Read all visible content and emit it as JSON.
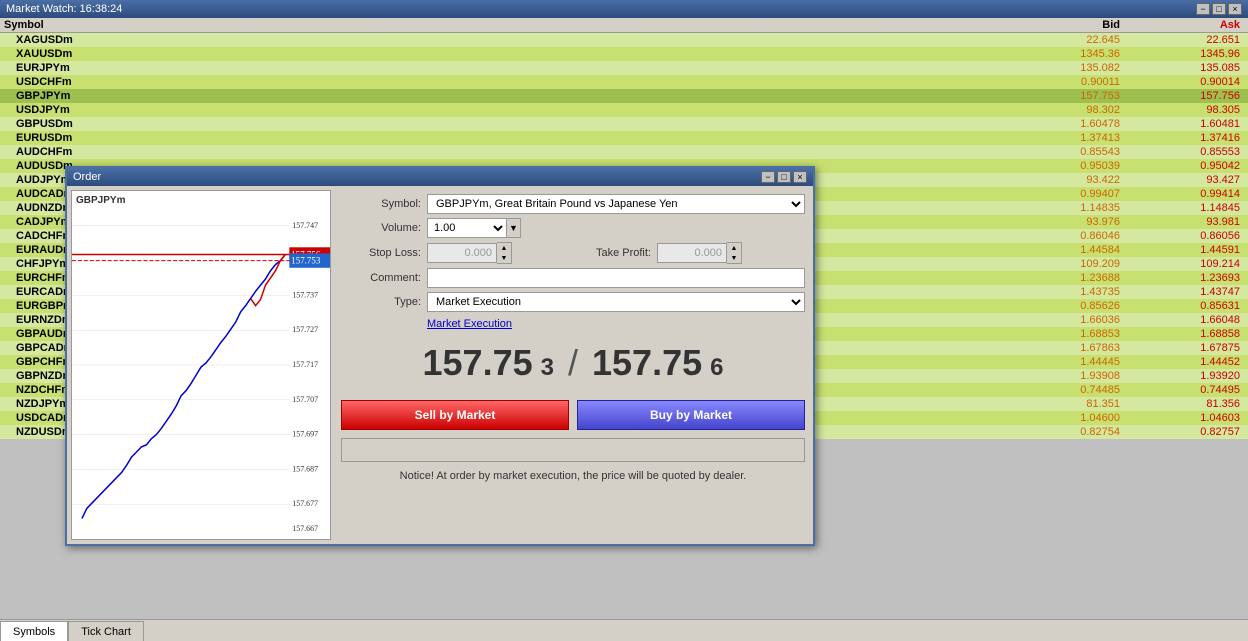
{
  "titleBar": {
    "title": "Market Watch: 16:38:24",
    "closeBtn": "×",
    "minBtn": "−",
    "maxBtn": "□"
  },
  "marketWatch": {
    "headers": {
      "symbol": "Symbol",
      "bid": "Bid",
      "ask": "Ask"
    },
    "rows": [
      {
        "symbol": "XAGUSDm",
        "bid": "22.645",
        "ask": "22.651",
        "askColor": "#cc0000"
      },
      {
        "symbol": "XAUUSDm",
        "bid": "1345.36",
        "ask": "1345.96",
        "askColor": "#cc0000"
      },
      {
        "symbol": "EURJPYm",
        "bid": "135.082",
        "ask": "135.085",
        "askColor": "#cc0000"
      },
      {
        "symbol": "USDCHFm",
        "bid": "0.90011",
        "ask": "0.90014",
        "askColor": "#cc0000"
      },
      {
        "symbol": "GBPJPYm",
        "bid": "157.753",
        "ask": "157.756",
        "bidColor": "#cc6600",
        "askColor": "#cc0000"
      },
      {
        "symbol": "USDJPYm",
        "bid": "98.302",
        "ask": "98.305",
        "askColor": "#cc0000"
      },
      {
        "symbol": "GBPUSDm",
        "bid": "1.60478",
        "ask": "1.60481",
        "askColor": "#cc0000"
      },
      {
        "symbol": "EURUSDm",
        "bid": "1.37413",
        "ask": "1.37416",
        "askColor": "#cc0000"
      },
      {
        "symbol": "AUDCHFm",
        "bid": "0.85543",
        "ask": "0.85553",
        "askColor": "#cc0000"
      },
      {
        "symbol": "AUDUSDm",
        "bid": "0.95039",
        "ask": "0.95042",
        "askColor": "#cc0000"
      },
      {
        "symbol": "AUDJPYm",
        "bid": "93.422",
        "ask": "93.427",
        "bidColor": "#cc6600",
        "askColor": "#cc0000"
      },
      {
        "symbol": "AUDCADm",
        "bid": "0.99407",
        "ask": "0.99414",
        "askColor": "#cc0000"
      },
      {
        "symbol": "AUDNZDm",
        "bid": "1.14835",
        "ask": "1.14845",
        "askColor": "#cc0000"
      },
      {
        "symbol": "CADJPYm",
        "bid": "93.976",
        "ask": "93.981",
        "askColor": "#cc0000"
      },
      {
        "symbol": "CADCHFm",
        "bid": "0.86046",
        "ask": "0.86056",
        "askColor": "#cc0000"
      },
      {
        "symbol": "EURAUDm",
        "bid": "1.44584",
        "ask": "1.44591",
        "askColor": "#cc0000"
      },
      {
        "symbol": "CHFJPYm",
        "bid": "109.209",
        "ask": "109.214",
        "askColor": "#cc0000"
      },
      {
        "symbol": "EURCHFm",
        "bid": "1.23688",
        "ask": "1.23693",
        "askColor": "#cc0000"
      },
      {
        "symbol": "EURCADm",
        "bid": "1.43735",
        "ask": "1.43747",
        "askColor": "#cc0000"
      },
      {
        "symbol": "EURGBPm",
        "bid": "0.85626",
        "ask": "0.85631",
        "askColor": "#cc0000"
      },
      {
        "symbol": "EURNZDm",
        "bid": "1.66036",
        "ask": "1.66048",
        "askColor": "#cc0000"
      },
      {
        "symbol": "GBPAUDm",
        "bid": "1.68853",
        "ask": "1.68858",
        "askColor": "#cc0000"
      },
      {
        "symbol": "GBPCADm",
        "bid": "1.67863",
        "ask": "1.67875",
        "askColor": "#cc0000"
      },
      {
        "symbol": "GBPCHFm",
        "bid": "1.44445",
        "ask": "1.44452",
        "askColor": "#cc0000"
      },
      {
        "symbol": "GBPNZDm",
        "bid": "1.93908",
        "ask": "1.93920",
        "askColor": "#cc0000"
      },
      {
        "symbol": "NZDCHFm",
        "bid": "0.74485",
        "ask": "0.74495",
        "askColor": "#cc0000"
      },
      {
        "symbol": "NZDJPYm",
        "bid": "81.351",
        "ask": "81.356",
        "askColor": "#cc0000"
      },
      {
        "symbol": "USDCADm",
        "bid": "1.04600",
        "ask": "1.04603",
        "askColor": "#cc0000"
      },
      {
        "symbol": "NZDUSDm",
        "bid": "0.82754",
        "ask": "0.82757",
        "askColor": "#cc0000"
      }
    ]
  },
  "orderDialog": {
    "title": "Order",
    "symbolLabel": "Symbol:",
    "symbolValue": "GBPJPYm, Great Britain Pound vs Japanese Yen",
    "volumeLabel": "Volume:",
    "volumeValue": "1.00",
    "stopLossLabel": "Stop Loss:",
    "stopLossValue": "0.000",
    "takeProfitLabel": "Take Profit:",
    "takeProfitValue": "0.000",
    "commentLabel": "Comment:",
    "commentValue": "",
    "typeLabel": "Type:",
    "typeValue": "Market Execution",
    "marketExecutionLink": "Market Execution",
    "bidPrice": "157.753",
    "askPrice": "157.756",
    "bidBig": "157.75",
    "bidSmall": "3",
    "askBig": "157.75",
    "askSmall": "6",
    "sellBtn": "Sell by Market",
    "buyBtn": "Buy by Market",
    "noticeText": "Notice! At order by market execution, the price will be quoted by dealer.",
    "chartLabel": "GBPJPYm",
    "chartPrices": [
      "157.756",
      "157.747",
      "157.737",
      "157.727",
      "157.717",
      "157.707",
      "157.697",
      "157.687",
      "157.677",
      "157.667"
    ],
    "bidLineLabel": "157.756",
    "askLineLabel": "157.753"
  },
  "bottomTabs": {
    "tabs": [
      "Symbols",
      "Tick Chart"
    ]
  }
}
